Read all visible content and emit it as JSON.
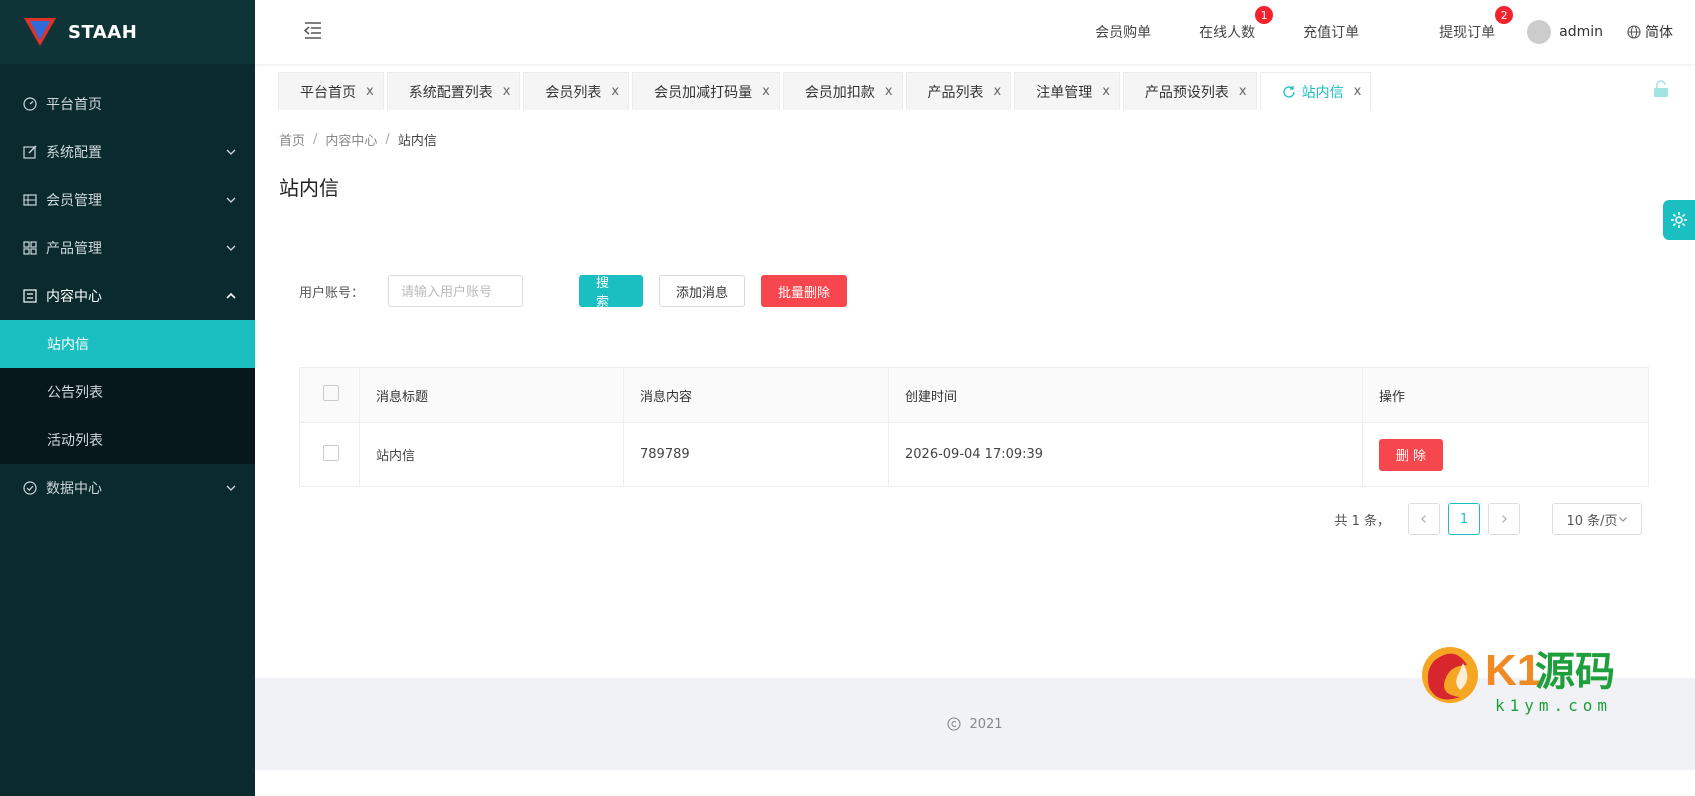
{
  "app": {
    "name": "STAAH"
  },
  "sidebar": {
    "items": [
      {
        "label": "平台首页",
        "icon": "dashboard-icon"
      },
      {
        "label": "系统配置",
        "icon": "edit-icon"
      },
      {
        "label": "会员管理",
        "icon": "table-icon"
      },
      {
        "label": "产品管理",
        "icon": "grid-icon"
      },
      {
        "label": "内容中心",
        "icon": "list-icon"
      },
      {
        "label": "数据中心",
        "icon": "check-circle-icon"
      }
    ],
    "content_sub": [
      {
        "label": "站内信"
      },
      {
        "label": "公告列表"
      },
      {
        "label": "活动列表"
      }
    ]
  },
  "header": {
    "links": [
      "会员购单",
      "在线人数",
      "充值订单",
      "提现订单"
    ],
    "online_badge": "1",
    "withdraw_badge": "2",
    "user": "admin",
    "lang": "简体"
  },
  "tabs": [
    {
      "label": "平台首页"
    },
    {
      "label": "系统配置列表"
    },
    {
      "label": "会员列表"
    },
    {
      "label": "会员加减打码量"
    },
    {
      "label": "会员加扣款"
    },
    {
      "label": "产品列表"
    },
    {
      "label": "注单管理"
    },
    {
      "label": "产品预设列表"
    },
    {
      "label": "站内信"
    }
  ],
  "tab_close": "x",
  "breadcrumb": {
    "home": "首页",
    "parent": "内容中心",
    "current": "站内信",
    "sep": "/"
  },
  "page_title": "站内信",
  "filter": {
    "label": "用户账号：",
    "placeholder": "请输入用户账号",
    "search": "搜 索",
    "add": "添加消息",
    "batch_delete": "批量删除"
  },
  "table": {
    "headers": [
      "消息标题",
      "消息内容",
      "创建时间",
      "操作"
    ],
    "rows": [
      {
        "title": "站内信",
        "content": "789789",
        "time": "2026-09-04 17:09:39",
        "action": "删 除"
      }
    ]
  },
  "pagination": {
    "total": "共 1 条，",
    "page": "1",
    "size": "10 条/页"
  },
  "footer": {
    "text": "2021"
  },
  "watermark": {
    "brand": "K1源码",
    "url": "k1ym.com"
  },
  "colors": {
    "accent": "#1bbfc1",
    "danger": "#f5474d",
    "sidebar": "#0b2a2e"
  }
}
